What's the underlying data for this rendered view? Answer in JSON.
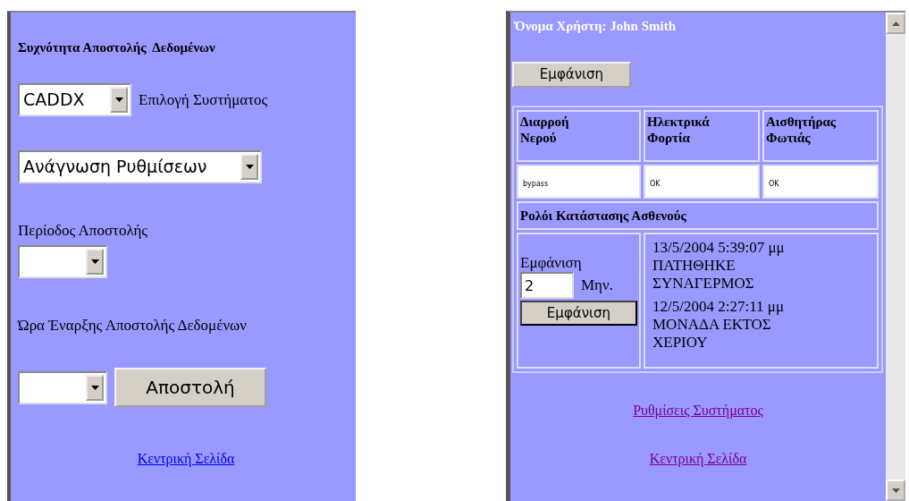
{
  "left_panel": {
    "heading": "Συχνότητα Αποστολής  Δεδομένων",
    "system_select": {
      "value": "CADDX"
    },
    "system_label": "Επιλογή Συστήματος",
    "mode_select": {
      "value": "Ανάγνωση Ρυθμίσεων"
    },
    "period_label": "Περίοδος Αποστολής",
    "start_label": "Ώρα Έναρξης Αποστολής Δεδομένων",
    "send_button": "Αποστολή",
    "link": {
      "label": "Κεντρική Σελίδα",
      "visited": false
    }
  },
  "right_panel": {
    "user_title": "Όνομα Χρήστη: John Smith",
    "show_button": "Εμφάνιση",
    "sensors": {
      "columns": [
        "Διαρροή Νερού",
        "Ηλεκτρικά Φορτία",
        "Αισθητήρας Φωτιάς"
      ],
      "rows": [
        [
          "bypass",
          "OK",
          "OK"
        ]
      ]
    },
    "status_log": {
      "title": "Ρολόι Κατάστασης Ασθενούς",
      "show_label": "Εμφάνιση",
      "months_value": "2",
      "months_unit": "Μην.",
      "show_button": "Εμφάνιση",
      "events": [
        {
          "date": "13/5/2004 5:39:07 μμ",
          "message": "ΠΑΤΗΘΗΚΕ ΣΥΝΑΓΕΡΜΟΣ"
        },
        {
          "date": "12/5/2004 2:27:11 μμ",
          "message": "ΜΟΝΑΔΑ ΕΚΤΟΣ ΧΕΡΙΟΥ"
        }
      ]
    },
    "links": [
      {
        "label": "Ρυθμίσεις Συστήματος",
        "visited": true
      },
      {
        "label": "Κεντρική Σελίδα",
        "visited": true
      }
    ]
  }
}
